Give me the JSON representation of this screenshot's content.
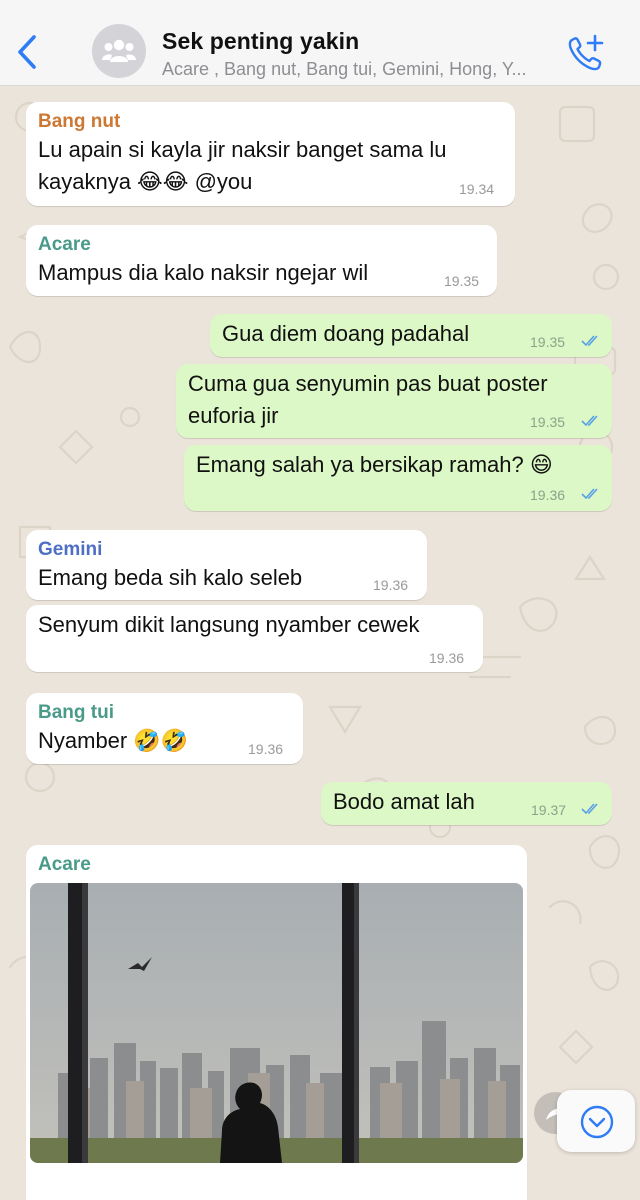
{
  "header": {
    "title": "Sek penting yakin",
    "subtitle": "Acare , Bang nut, Bang tui, Gemini, Hong, Y..."
  },
  "colors": {
    "bang_nut": "#cd7832",
    "acare": "#4a9a8a",
    "gemini": "#4e6fc4",
    "bang_tui": "#4a9a8a",
    "ios_blue": "#2f7cf6"
  },
  "messages": [
    {
      "id": 1,
      "direction": "in",
      "sender": "Bang nut",
      "lines": [
        "Lu apain si kayla jir naksir banget sama lu",
        "kayaknya 😂😂 @you"
      ],
      "time": "19.34"
    },
    {
      "id": 2,
      "direction": "in",
      "sender": "Acare",
      "lines": [
        "Mampus dia kalo naksir ngejar wil"
      ],
      "time": "19.35"
    },
    {
      "id": 3,
      "direction": "out",
      "lines": [
        "Gua diem doang padahal"
      ],
      "time": "19.35"
    },
    {
      "id": 4,
      "direction": "out",
      "lines": [
        "Cuma gua senyumin pas buat poster",
        "euforia jir"
      ],
      "time": "19.35"
    },
    {
      "id": 5,
      "direction": "out",
      "lines": [
        "Emang salah ya bersikap ramah? 😄"
      ],
      "time": "19.36"
    },
    {
      "id": 6,
      "direction": "in",
      "sender": "Gemini",
      "lines": [
        "Emang beda sih kalo seleb"
      ],
      "time": "19.36"
    },
    {
      "id": 7,
      "direction": "in",
      "lines": [
        "Senyum dikit langsung nyamber cewek"
      ],
      "time": "19.36"
    },
    {
      "id": 8,
      "direction": "in",
      "sender": "Bang tui",
      "lines": [
        "Nyamber 🤣🤣"
      ],
      "time": "19.36"
    },
    {
      "id": 9,
      "direction": "out",
      "lines": [
        "Bodo amat lah"
      ],
      "time": "19.37"
    },
    {
      "id": 10,
      "direction": "in",
      "sender": "Acare",
      "media": "photo"
    }
  ]
}
